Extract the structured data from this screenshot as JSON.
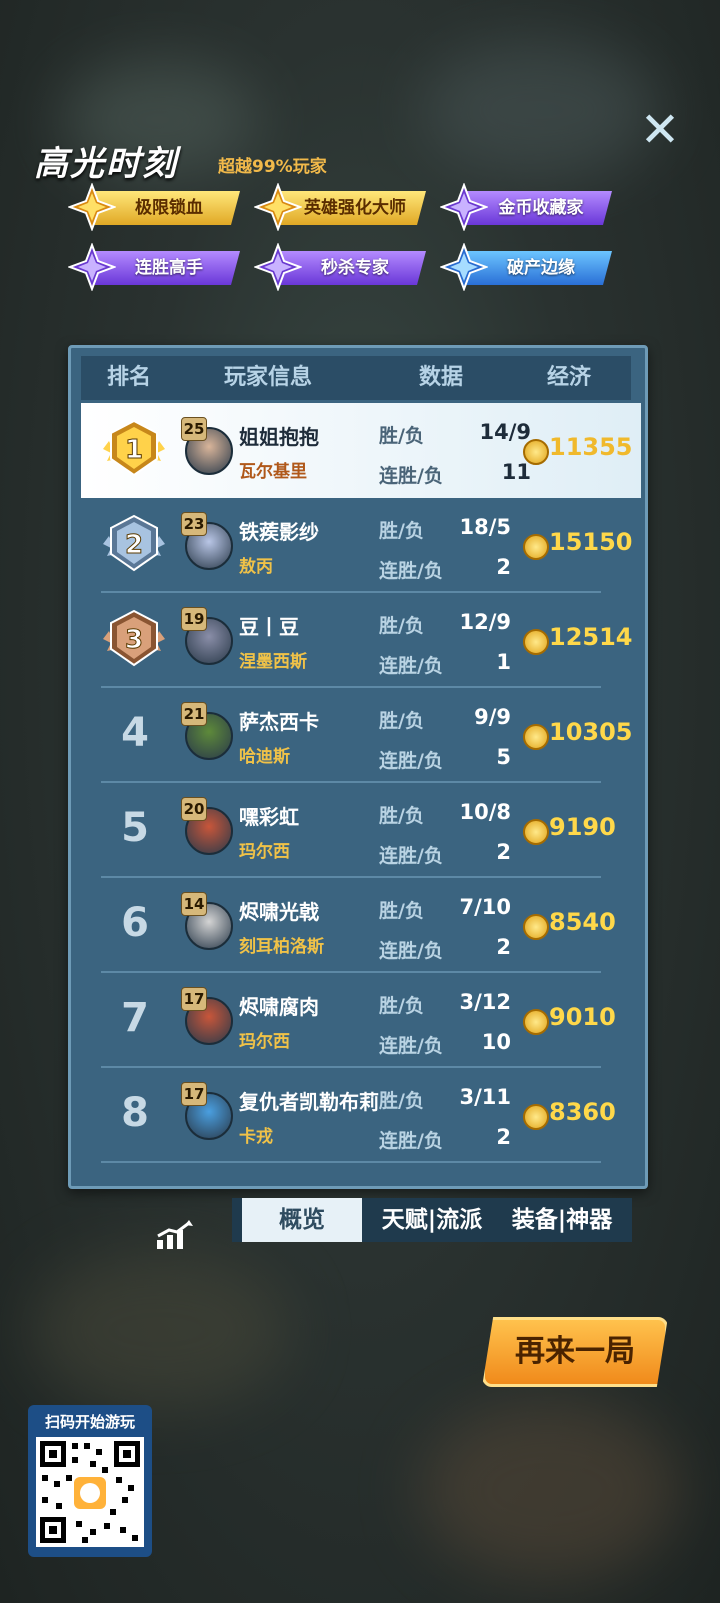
{
  "highlight": {
    "title": "高光时刻",
    "subtitle": "超越99%玩家",
    "badges": [
      {
        "label": "极限锁血",
        "style": "gold"
      },
      {
        "label": "英雄强化大师",
        "style": "gold"
      },
      {
        "label": "金币收藏家",
        "style": "purple"
      },
      {
        "label": "连胜高手",
        "style": "purple"
      },
      {
        "label": "秒杀专家",
        "style": "purple"
      },
      {
        "label": "破产边缘",
        "style": "blue"
      }
    ]
  },
  "table": {
    "headers": {
      "rank": "排名",
      "player": "玩家信息",
      "data": "数据",
      "economy": "经济"
    },
    "stat_labels": {
      "winloss": "胜/负",
      "streak": "连胜/负"
    },
    "rows": [
      {
        "rank": "1",
        "level": "25",
        "name": "姐姐抱抱",
        "hero": "瓦尔基里",
        "winloss": "14/9",
        "streak": "11",
        "gold": "11355"
      },
      {
        "rank": "2",
        "level": "23",
        "name": "铁蒺影纱",
        "hero": "敖丙",
        "winloss": "18/5",
        "streak": "2",
        "gold": "15150"
      },
      {
        "rank": "3",
        "level": "19",
        "name": "豆丨豆",
        "hero": "涅墨西斯",
        "winloss": "12/9",
        "streak": "1",
        "gold": "12514"
      },
      {
        "rank": "4",
        "level": "21",
        "name": "萨杰西卡",
        "hero": "哈迪斯",
        "winloss": "9/9",
        "streak": "5",
        "gold": "10305"
      },
      {
        "rank": "5",
        "level": "20",
        "name": "嘿彩虹",
        "hero": "玛尔西",
        "winloss": "10/8",
        "streak": "2",
        "gold": "9190"
      },
      {
        "rank": "6",
        "level": "14",
        "name": "烬啸光戟",
        "hero": "刻耳柏洛斯",
        "winloss": "7/10",
        "streak": "2",
        "gold": "8540"
      },
      {
        "rank": "7",
        "level": "17",
        "name": "烬啸腐肉",
        "hero": "玛尔西",
        "winloss": "3/12",
        "streak": "10",
        "gold": "9010"
      },
      {
        "rank": "8",
        "level": "17",
        "name": "复仇者凯勒布莉",
        "hero": "卡戎",
        "winloss": "3/11",
        "streak": "2",
        "gold": "8360"
      }
    ]
  },
  "tabs": {
    "overview": "概览",
    "talent": "天赋|流派",
    "equip": "装备|神器"
  },
  "again_button": "再来一局",
  "qr_label": "扫码开始游玩",
  "colors": {
    "gold_text": "#ffd84a",
    "panel": "#3b6480",
    "accent_orange": "#f08a1b"
  }
}
